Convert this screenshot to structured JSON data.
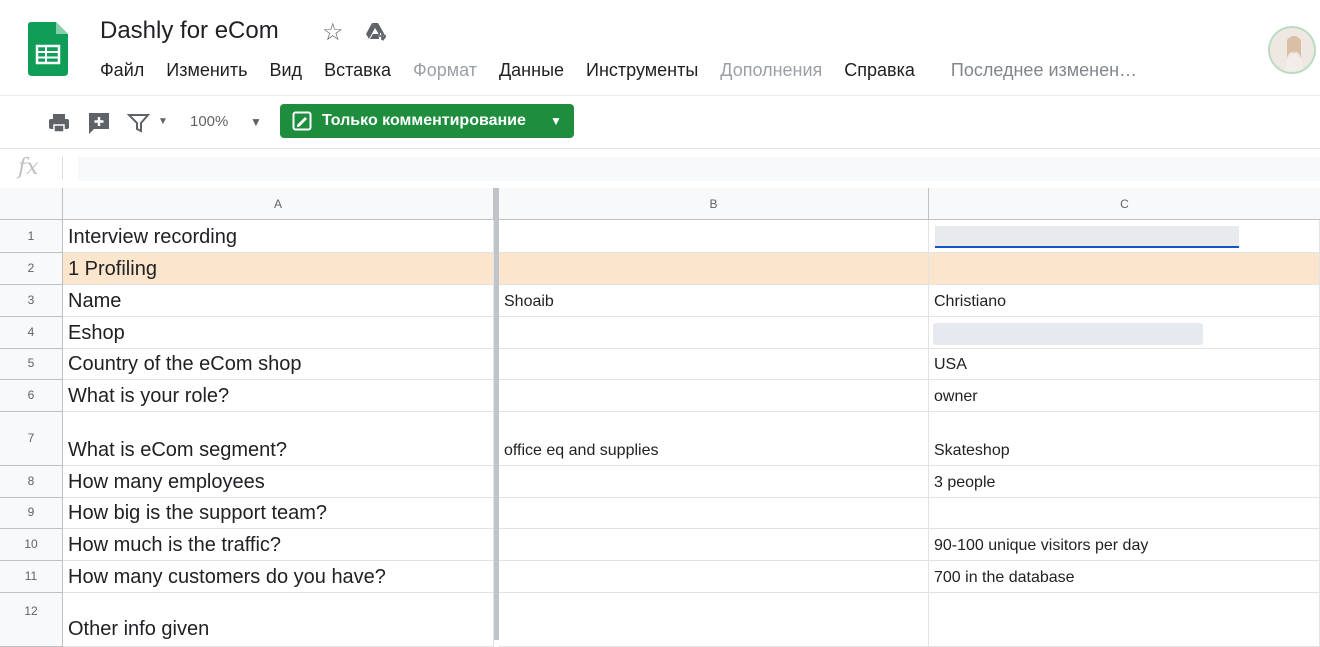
{
  "app": {
    "title": "Dashly for eCom",
    "icons": [
      "sheets-logo",
      "star-icon",
      "drive-move-icon",
      "avatar"
    ]
  },
  "menu": {
    "items": [
      "Файл",
      "Изменить",
      "Вид",
      "Вставка",
      "Формат",
      "Данные",
      "Инструменты",
      "Дополнения",
      "Справка"
    ],
    "last_edit": "Последнее изменен…"
  },
  "toolbar": {
    "zoom": "100%",
    "comment_mode": "Только комментирование",
    "icons": [
      "print-icon",
      "add-comment-icon",
      "filter-icon"
    ]
  },
  "formula_bar": {
    "fx": "fx",
    "value": ""
  },
  "columns": [
    "A",
    "B",
    "C"
  ],
  "rows": [
    {
      "num": "1",
      "a": "Interview recording",
      "b": "",
      "c": ""
    },
    {
      "num": "2",
      "a": "1 Profiling",
      "b": "",
      "c": ""
    },
    {
      "num": "3",
      "a": "Name",
      "b": "Shoaib",
      "c": "Christiano"
    },
    {
      "num": "4",
      "a": "Eshop",
      "b": "",
      "c": ""
    },
    {
      "num": "5",
      "a": "Country of the eCom shop",
      "b": "",
      "c": "USA"
    },
    {
      "num": "6",
      "a": "What is your role?",
      "b": "",
      "c": "owner"
    },
    {
      "num": "7",
      "a": "What is eCom segment?",
      "b": "office eq and supplies",
      "c": "Skateshop"
    },
    {
      "num": "8",
      "a": "How many employees",
      "b": "",
      "c": "3 people"
    },
    {
      "num": "9",
      "a": "How big is the support team?",
      "b": "",
      "c": ""
    },
    {
      "num": "10",
      "a": "How much is the traffic?",
      "b": "",
      "c": "90-100 unique visitors per day"
    },
    {
      "num": "11",
      "a": "How many customers do you have?",
      "b": "",
      "c": "700 in the database"
    },
    {
      "num": "12",
      "a": "Other info given",
      "b": "",
      "c": ""
    }
  ],
  "colors": {
    "brand_green": "#1e8e3e",
    "profiling_fill": "#fce5cd",
    "link_blue": "#1155cc"
  }
}
